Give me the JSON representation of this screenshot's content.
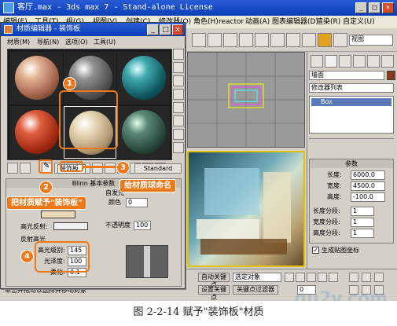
{
  "app": {
    "title": "客厅.max - 3ds max 7 - Stand-alone License",
    "menu": [
      "编辑(E)",
      "工具(T)",
      "组(G)",
      "视图(V)",
      "创建(C)",
      "修改器(O)",
      "角色(H)",
      "reactor",
      "动画(A)",
      "图表编辑器(D)",
      "渲染(R)",
      "自定义(U)"
    ],
    "view_dropdown": "视图",
    "viewport_label": "Box"
  },
  "material_editor": {
    "title": "材质编辑器 - 装饰板",
    "menu": [
      "材质(M)",
      "导航(N)",
      "选项(O)",
      "工具(U)"
    ],
    "material_name": "装饰板",
    "material_type": "Standard",
    "shader_rollout": "Blinn 基本参数",
    "self_illum": "自发光",
    "color_label": "颜色",
    "color_value": "0",
    "opacity_label": "不透明度",
    "opacity_value": "100",
    "specular_label": "高光反射:",
    "reflect_highlight": "反射高光",
    "spec_level_label": "高光级别:",
    "spec_level_value": "145",
    "glossiness_label": "光泽度:",
    "glossiness_value": "100",
    "soften_label": "柔化:",
    "soften_value": "0.1"
  },
  "callouts": {
    "b1": "1",
    "b2": "2",
    "b3": "3",
    "b4": "4",
    "assign_text": "把材质赋予\"装饰板\"",
    "name_text": "给材质球命名"
  },
  "command_panel": {
    "object_name": "墙面",
    "modifier_list": "修改器列表",
    "stack_item": "Box",
    "params_title": "参数",
    "length_label": "长度:",
    "length_value": "6000.0",
    "width_label": "宽度:",
    "width_value": "4500.0",
    "height_label": "高度:",
    "height_value": "-100.0",
    "len_segs_label": "长度分段:",
    "len_segs_value": "1",
    "wid_segs_label": "宽度分段:",
    "wid_segs_value": "1",
    "hei_segs_label": "高度分段:",
    "hei_segs_value": "1",
    "gen_mapping": "生成贴图坐标"
  },
  "status": {
    "auto_key": "自动关键点",
    "selected": "选定对象",
    "set_key": "设置关键点",
    "key_filter": "关键点过滤器",
    "prompt": "单击并拖动以选择并移动对象",
    "frame": "0"
  },
  "figure_caption": "图 2-2-14   赋予\"装饰板\"材质",
  "watermark": "gu2y.com",
  "colors": {
    "accent_orange": "#f07818",
    "title_blue": "#0a3fb8"
  }
}
